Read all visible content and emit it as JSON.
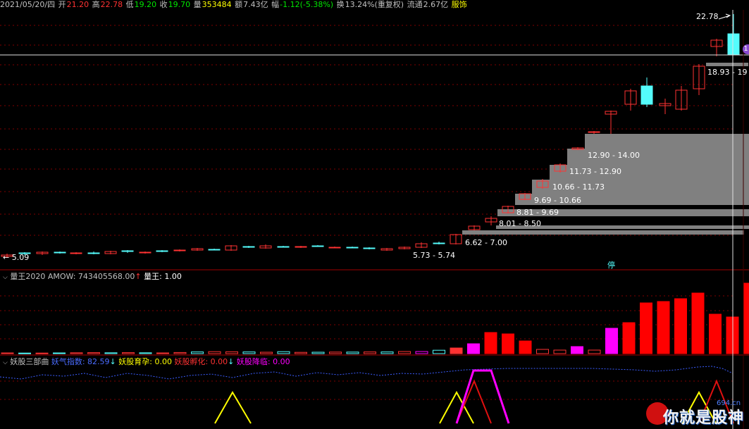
{
  "header": {
    "date": "2021/05/20/四",
    "open_label": "开",
    "open": "21.20",
    "high_label": "高",
    "high": "22.78",
    "low_label": "低",
    "low": "19.20",
    "close_label": "收",
    "close": "19.70",
    "volume_label": "量",
    "volume": "353484",
    "amount_label": "额",
    "amount": "7.43亿",
    "change_label": "幅",
    "change": "-1.12(-5.38%)",
    "turnover_label": "换",
    "turnover": "13.24%(重复权)",
    "float_label": "流通",
    "float": "2.67亿",
    "sector": "服饰"
  },
  "price_panel": {
    "high_marker": "22.78",
    "low_marker": "5.09",
    "limit_badge": "停",
    "edge_char": "1",
    "zones": [
      {
        "label": "5.73 - 5.74"
      },
      {
        "label": "6.62 - 7.00"
      },
      {
        "label": "8.01 - 8.50"
      },
      {
        "label": "8.81 - 9.69"
      },
      {
        "label": "9.69 - 10.66"
      },
      {
        "label": "10.66 - 11.73"
      },
      {
        "label": "11.73 - 12.90"
      },
      {
        "label": "12.90 - 14.00"
      },
      {
        "label": "18.93 - 19"
      }
    ]
  },
  "volume_panel": {
    "title": "量王2020",
    "amow_label": "AMOW: 743405568.00",
    "amow_arrow": "↑",
    "wang_label": "量王: 1.00",
    "values": [
      0.5,
      0.4,
      0.4,
      0.5,
      0.6,
      0.7,
      0.6,
      0.7,
      0.6,
      0.5,
      0.8,
      1.2,
      1.4,
      1.3,
      1.2,
      1.0,
      1.4,
      0.9,
      1.0,
      1.1,
      1.1,
      1.2,
      1.2,
      1.5,
      1.5,
      2.4,
      4.0,
      7.0,
      15,
      14,
      9,
      3,
      2.5,
      5,
      2.5,
      18,
      22,
      36,
      37,
      39,
      43,
      28,
      26,
      50
    ]
  },
  "indicator_panel": {
    "title": "妖股三部曲",
    "yaoqi_label": "妖气指数: 82.59",
    "yaoqi_arrow": "↓",
    "yunyu_label": "妖股育孕: 0.00",
    "fuhua_label": "妖股孵化: 0.00",
    "fuhua_arrow": "↓",
    "jianglin_label": "妖股降临: 0.00"
  },
  "watermark": {
    "text": "你就是股神",
    "site": "694.cn"
  },
  "colors": {
    "up": "#ff3232",
    "down": "#54fcfc",
    "magenta": "#ff00ff",
    "yellow": "#ffff00",
    "grid": "#800000",
    "zone": "#808080"
  }
}
